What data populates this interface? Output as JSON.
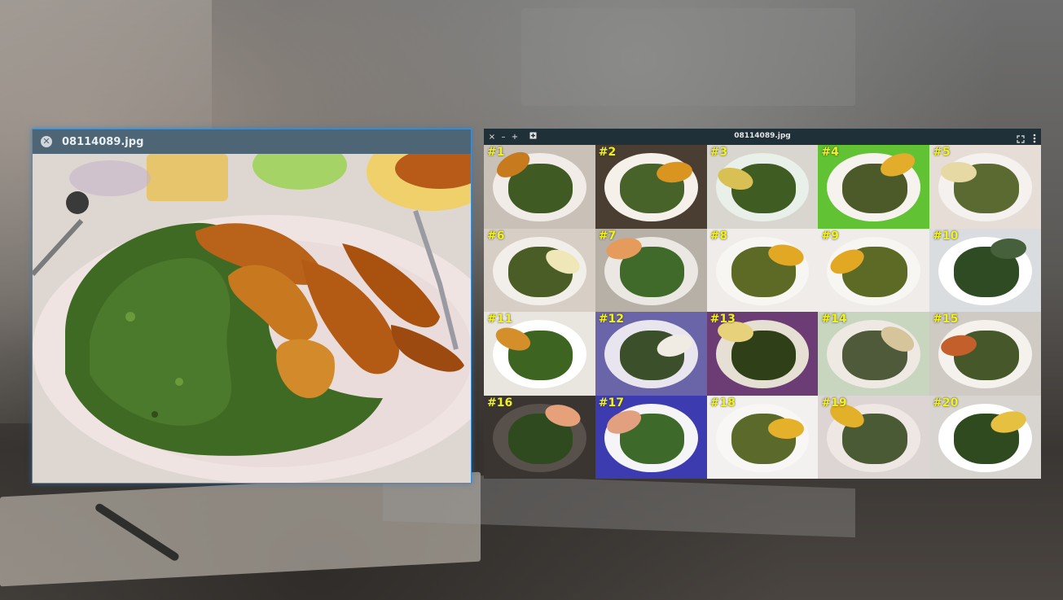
{
  "left_window": {
    "title": "08114089.jpg",
    "close_icon": "close-icon"
  },
  "right_window": {
    "title": "08114089.jpg",
    "controls": {
      "close": "×",
      "minus": "–",
      "plus": "+"
    },
    "thumbnails": [
      {
        "label": "#1",
        "bg": "#c9c1b8",
        "plate": "#f1ece8",
        "greens": "#3f5a22",
        "plantain": "#c77a1e"
      },
      {
        "label": "#2",
        "bg": "#4a3d32",
        "plate": "#f5f1ea",
        "greens": "#47632a",
        "plantain": "#d9951f"
      },
      {
        "label": "#3",
        "bg": "#d8d6cf",
        "plate": "#e9efe9",
        "greens": "#3f5c22",
        "plantain": "#d9c055"
      },
      {
        "label": "#4",
        "bg": "#61c233",
        "plate": "#f6f3ee",
        "greens": "#4c5a2a",
        "plantain": "#e3ad2b"
      },
      {
        "label": "#5",
        "bg": "#e6ddd6",
        "plate": "#f4f1ee",
        "greens": "#5a6a30",
        "plantain": "#e7d9a3"
      },
      {
        "label": "#6",
        "bg": "#d7cfc6",
        "plate": "#f2eee9",
        "greens": "#4a5d26",
        "plantain": "#efe7b8"
      },
      {
        "label": "#7",
        "bg": "#b7b0a7",
        "plate": "#ebe7e2",
        "greens": "#3f6a2a",
        "plantain": "#e49b5b"
      },
      {
        "label": "#8",
        "bg": "#efecea",
        "plate": "#f8f6f3",
        "greens": "#5c6a26",
        "plantain": "#e3a823"
      },
      {
        "label": "#9",
        "bg": "#efecea",
        "plate": "#f8f6f3",
        "greens": "#5c6a26",
        "plantain": "#e3a823"
      },
      {
        "label": "#10",
        "bg": "#d9dde0",
        "plate": "#ffffff",
        "greens": "#2f4b24",
        "plantain": "#45603a"
      },
      {
        "label": "#11",
        "bg": "#e9e5df",
        "plate": "#ffffff",
        "greens": "#3e6422",
        "plantain": "#d58f2a"
      },
      {
        "label": "#12",
        "bg": "#6a64a8",
        "plate": "#e8e5ee",
        "greens": "#3b4f2a",
        "plantain": "#f0ece4"
      },
      {
        "label": "#13",
        "bg": "#6b3d74",
        "plate": "#e6dfd4",
        "greens": "#2f4018",
        "plantain": "#e7d17a"
      },
      {
        "label": "#14",
        "bg": "#c8d6c0",
        "plate": "#efe9e4",
        "greens": "#4f5a3a",
        "plantain": "#d6c49a"
      },
      {
        "label": "#15",
        "bg": "#cfcac3",
        "plate": "#f5f2ee",
        "greens": "#46582a",
        "plantain": "#c35f2a"
      },
      {
        "label": "#16",
        "bg": "#3b3532",
        "plate": "#58504a",
        "greens": "#2f4a1e",
        "plantain": "#e6a07a"
      },
      {
        "label": "#17",
        "bg": "#3d3bb0",
        "plate": "#f5f5f8",
        "greens": "#3d6a2a",
        "plantain": "#e3a080"
      },
      {
        "label": "#18",
        "bg": "#f2f1ef",
        "plate": "#f8f7f5",
        "greens": "#5b6a2a",
        "plantain": "#e6b12a"
      },
      {
        "label": "#19",
        "bg": "#ddd4d4",
        "plate": "#eee7e4",
        "greens": "#4a5a35",
        "plantain": "#e3b02a"
      },
      {
        "label": "#20",
        "bg": "#d8d4d0",
        "plate": "#ffffff",
        "greens": "#2f4a1e",
        "plantain": "#e6c040"
      }
    ]
  }
}
